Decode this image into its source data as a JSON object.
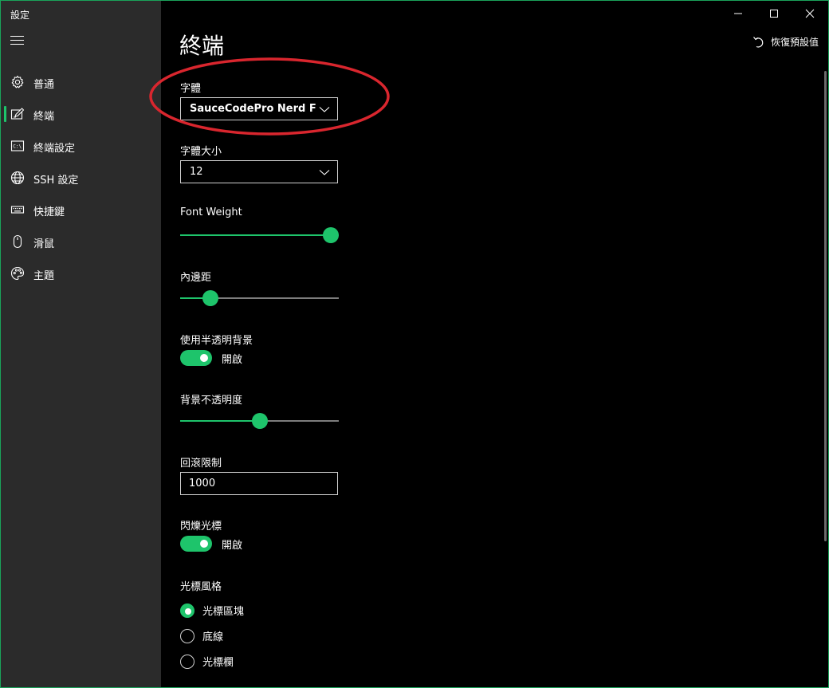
{
  "app": {
    "title": "設定"
  },
  "sidebar": {
    "items": [
      {
        "label": "普通",
        "icon": "gear-icon",
        "selected": false
      },
      {
        "label": "終端",
        "icon": "edit-icon",
        "selected": true
      },
      {
        "label": "終端設定",
        "icon": "terminal-icon",
        "selected": false
      },
      {
        "label": "SSH 設定",
        "icon": "globe-icon",
        "selected": false
      },
      {
        "label": "快捷鍵",
        "icon": "keyboard-icon",
        "selected": false
      },
      {
        "label": "滑鼠",
        "icon": "mouse-icon",
        "selected": false
      },
      {
        "label": "主題",
        "icon": "palette-icon",
        "selected": false
      }
    ]
  },
  "header": {
    "page_title": "終端",
    "reset_label": "恢復預設值"
  },
  "settings": {
    "font": {
      "label": "字體",
      "value": "SauceCodePro Nerd Font"
    },
    "font_size": {
      "label": "字體大小",
      "value": "12"
    },
    "font_weight": {
      "label": "Font Weight",
      "level": 0.95
    },
    "padding": {
      "label": "內邊距",
      "level": 0.19
    },
    "transparency": {
      "label": "使用半透明背景",
      "state": "開啟"
    },
    "opacity": {
      "label": "背景不透明度",
      "level": 0.5
    },
    "scrollback": {
      "label": "回滾限制",
      "value": "1000"
    },
    "cursor_blink": {
      "label": "閃爍光標",
      "state": "開啟"
    },
    "cursor_style": {
      "label": "光標風格",
      "options": [
        {
          "label": "光標區塊",
          "checked": true
        },
        {
          "label": "底線",
          "checked": false
        },
        {
          "label": "光標欄",
          "checked": false
        }
      ]
    }
  },
  "colors": {
    "accent": "#1ec46b",
    "sidebar_bg": "#2b2b2b",
    "main_bg": "#000000",
    "annotation": "#d9262e"
  }
}
